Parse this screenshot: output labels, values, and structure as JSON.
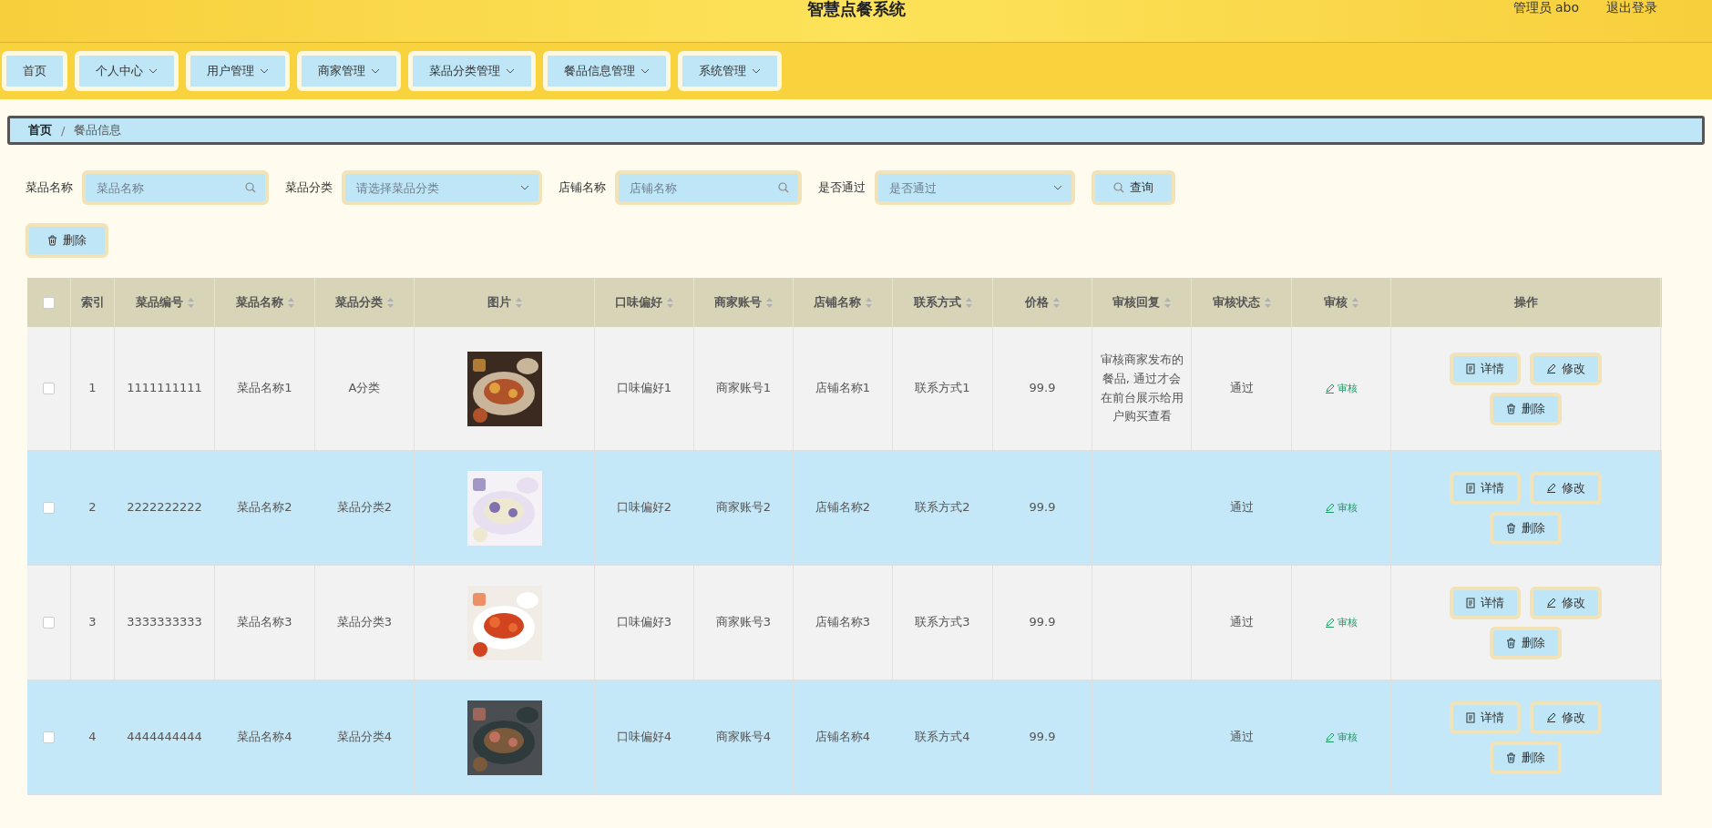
{
  "header": {
    "title": "智慧点餐系统",
    "user": "管理员 abo",
    "logout": "退出登录"
  },
  "nav": [
    {
      "label": "首页",
      "dropdown": false
    },
    {
      "label": "个人中心",
      "dropdown": true
    },
    {
      "label": "用户管理",
      "dropdown": true
    },
    {
      "label": "商家管理",
      "dropdown": true
    },
    {
      "label": "菜品分类管理",
      "dropdown": true
    },
    {
      "label": "餐品信息管理",
      "dropdown": true
    },
    {
      "label": "系统管理",
      "dropdown": true
    }
  ],
  "breadcrumb": {
    "items": [
      "首页",
      "餐品信息"
    ],
    "separator": "/"
  },
  "filters": [
    {
      "label": "菜品名称",
      "kind": "input",
      "placeholder": "菜品名称"
    },
    {
      "label": "菜品分类",
      "kind": "select",
      "placeholder": "请选择菜品分类"
    },
    {
      "label": "店铺名称",
      "kind": "input",
      "placeholder": "店铺名称"
    },
    {
      "label": "是否通过",
      "kind": "select",
      "placeholder": "是否通过"
    }
  ],
  "search_button": "查询",
  "delete_button": "删除",
  "table": {
    "select_all": false,
    "columns": [
      {
        "label": "索引",
        "sortable": false
      },
      {
        "label": "菜品编号",
        "sortable": true
      },
      {
        "label": "菜品名称",
        "sortable": true
      },
      {
        "label": "菜品分类",
        "sortable": true
      },
      {
        "label": "图片",
        "sortable": true
      },
      {
        "label": "口味偏好",
        "sortable": true
      },
      {
        "label": "商家账号",
        "sortable": true
      },
      {
        "label": "店铺名称",
        "sortable": true
      },
      {
        "label": "联系方式",
        "sortable": true
      },
      {
        "label": "价格",
        "sortable": true
      },
      {
        "label": "审核回复",
        "sortable": true
      },
      {
        "label": "审核状态",
        "sortable": true
      },
      {
        "label": "审核",
        "sortable": true
      },
      {
        "label": "操作",
        "sortable": false
      }
    ],
    "rows": [
      {
        "checked": false,
        "cells": [
          "1",
          "1111111111",
          "菜品名称1",
          "A分类"
        ],
        "picture": {
          "kind": "picture"
        },
        "cells2": [
          "口味偏好1",
          "商家账号1",
          "店铺名称1",
          "联系方式1",
          "99.9"
        ],
        "reply": "审核商家发布的餐品, 通过才会在前台展示给用户购买查看",
        "status": "通过",
        "review": "审核",
        "actions": [
          "详情",
          "修改",
          "删除"
        ]
      },
      {
        "checked": false,
        "cells": [
          "2",
          "2222222222",
          "菜品名称2",
          "菜品分类2"
        ],
        "picture": {
          "kind": "picture"
        },
        "cells2": [
          "口味偏好2",
          "商家账号2",
          "店铺名称2",
          "联系方式2",
          "99.9"
        ],
        "status": "通过",
        "review": "审核",
        "actions": [
          "详情",
          "修改",
          "删除"
        ]
      },
      {
        "checked": false,
        "cells": [
          "3",
          "3333333333",
          "菜品名称3",
          "菜品分类3"
        ],
        "picture": {
          "kind": "picture"
        },
        "cells2": [
          "口味偏好3",
          "商家账号3",
          "店铺名称3",
          "联系方式3",
          "99.9"
        ],
        "status": "通过",
        "review": "审核",
        "actions": [
          "详情",
          "修改",
          "删除"
        ]
      },
      {
        "checked": false,
        "cells": [
          "4",
          "4444444444",
          "菜品名称4",
          "菜品分类4"
        ],
        "picture": {
          "kind": "picture"
        },
        "cells2": [
          "口味偏好4",
          "商家账号4",
          "店铺名称4",
          "联系方式4",
          "99.9"
        ],
        "status": "通过",
        "review": "审核",
        "actions": [
          "详情",
          "修改",
          "删除"
        ]
      }
    ]
  }
}
